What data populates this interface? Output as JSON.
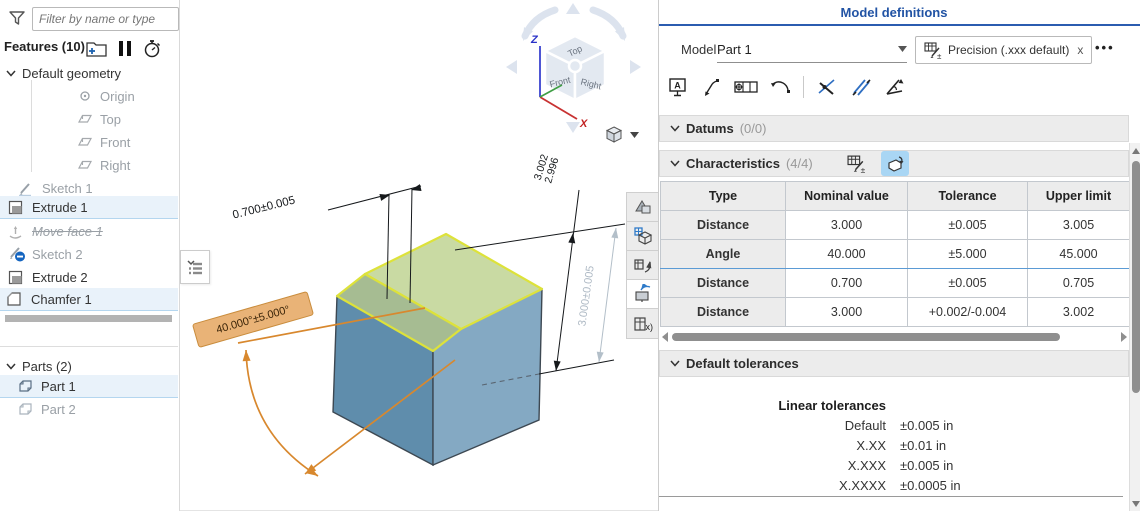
{
  "app": {
    "accent_blue": "#2153a4",
    "selection_blue": "#5b9bd5",
    "dimension_orange": "#d8882e",
    "highlight_yellow": "#dde23a",
    "part_left_face": "#5f8dac",
    "part_right_face": "#84a9c3",
    "part_top_face": "#c9daa3"
  },
  "sidebar": {
    "filter_placeholder": "Filter by name or type",
    "features_header": "Features (10)",
    "default_geometry_label": "Default geometry",
    "geometry_children": [
      "Origin",
      "Top",
      "Front",
      "Right"
    ],
    "features": [
      "Sketch 1",
      "Extrude 1",
      "Move face 1",
      "Sketch 2",
      "Extrude 2",
      "Chamfer 1"
    ],
    "parts_header": "Parts (2)",
    "parts": [
      "Part 1",
      "Part 2"
    ]
  },
  "viewport": {
    "view_cube": {
      "top": "Top",
      "front": "Front",
      "right": "Right",
      "axis_z": "Z",
      "axis_x": "X"
    },
    "dimensions": {
      "chamfer_width": "0.700±0.005",
      "angle": "40.000°±5.000°",
      "height_upper": "3.002",
      "height_lower": "2.996",
      "height_toleranced": "3.000±0.005"
    }
  },
  "panel": {
    "title": "Model definitions",
    "model_label": "Model",
    "model_value": "Part 1",
    "precision_chip": "Precision (.xxx default)",
    "precision_chip_close": "x",
    "overflow_menu": "•••",
    "datums_label": "Datums",
    "datums_count": "(0/0)",
    "characteristics_label": "Characteristics",
    "characteristics_count": "(4/4)",
    "table": {
      "headers": [
        "Type",
        "Nominal value",
        "Tolerance",
        "Upper limit"
      ],
      "rows": [
        {
          "type": "Distance",
          "nominal": "3.000",
          "tolerance": "±0.005",
          "upper": "3.005"
        },
        {
          "type": "Angle",
          "nominal": "40.000",
          "tolerance": "±5.000",
          "upper": "45.000"
        },
        {
          "type": "Distance",
          "nominal": "0.700",
          "tolerance": "±0.005",
          "upper": "0.705"
        },
        {
          "type": "Distance",
          "nominal": "3.000",
          "tolerance": "+0.002/-0.004",
          "upper": "3.002"
        }
      ]
    },
    "default_tolerances_label": "Default tolerances",
    "linear_tolerances": {
      "heading": "Linear tolerances",
      "rows": [
        {
          "label": "Default",
          "value": "±0.005 in"
        },
        {
          "label": "X.XX",
          "value": "±0.01 in"
        },
        {
          "label": "X.XXX",
          "value": "±0.005 in"
        },
        {
          "label": "X.XXXX",
          "value": "±0.0005 in"
        }
      ]
    }
  }
}
